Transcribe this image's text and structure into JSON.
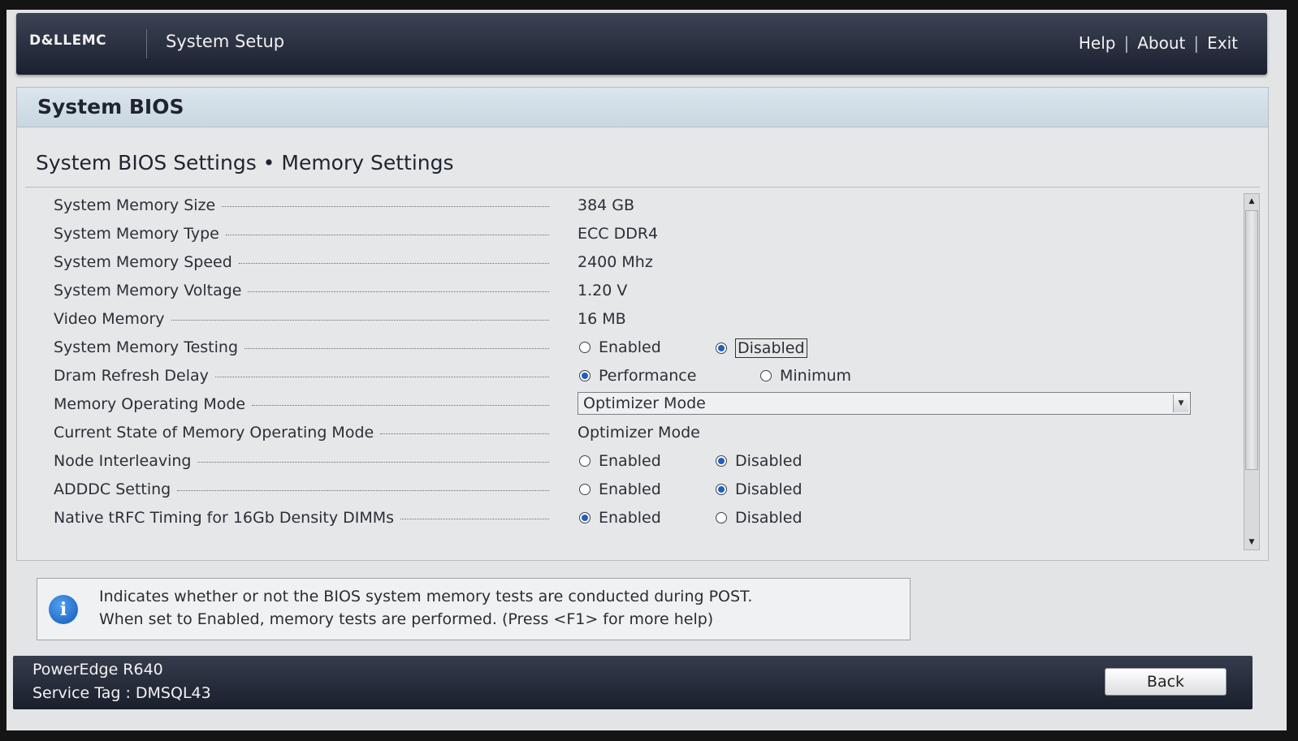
{
  "header": {
    "brand": "D&LLEMC",
    "title": "System Setup",
    "links": [
      "Help",
      "About",
      "Exit"
    ]
  },
  "panel": {
    "title": "System BIOS",
    "subtitle": "System BIOS Settings • Memory Settings"
  },
  "settings": {
    "memory_size": {
      "label": "System Memory Size",
      "value": "384 GB"
    },
    "memory_type": {
      "label": "System Memory Type",
      "value": "ECC DDR4"
    },
    "memory_speed": {
      "label": "System Memory Speed",
      "value": "2400 Mhz"
    },
    "memory_voltage": {
      "label": "System Memory Voltage",
      "value": "1.20 V"
    },
    "video_memory": {
      "label": "Video Memory",
      "value": "16 MB"
    },
    "memory_testing": {
      "label": "System Memory Testing",
      "option_a": "Enabled",
      "option_b": "Disabled",
      "selected": "Disabled"
    },
    "dram_refresh": {
      "label": "Dram Refresh Delay",
      "option_a": "Performance",
      "option_b": "Minimum",
      "selected": "Performance"
    },
    "operating_mode": {
      "label": "Memory Operating Mode",
      "value": "Optimizer Mode"
    },
    "current_mode": {
      "label": "Current State of Memory Operating Mode",
      "value": "Optimizer Mode"
    },
    "node_interleaving": {
      "label": "Node Interleaving",
      "option_a": "Enabled",
      "option_b": "Disabled",
      "selected": "Disabled"
    },
    "adddc": {
      "label": "ADDDC Setting",
      "option_a": "Enabled",
      "option_b": "Disabled",
      "selected": "Disabled"
    },
    "native_trfc": {
      "label": "Native tRFC Timing for 16Gb Density DIMMs",
      "option_a": "Enabled",
      "option_b": "Disabled",
      "selected": "Enabled"
    }
  },
  "info": {
    "icon": "info-icon",
    "line1": "Indicates whether or not the BIOS system memory tests are conducted during POST.",
    "line2": "When set to Enabled, memory tests are performed. (Press <F1> for more help)"
  },
  "footer": {
    "model": "PowerEdge R640",
    "service_tag": "Service Tag : DMSQL43",
    "back_label": "Back"
  },
  "colors": {
    "header_bg": "#1b2030",
    "panel_title_bg": "#c9d7e1",
    "radio_selected": "#1f5fbf"
  }
}
